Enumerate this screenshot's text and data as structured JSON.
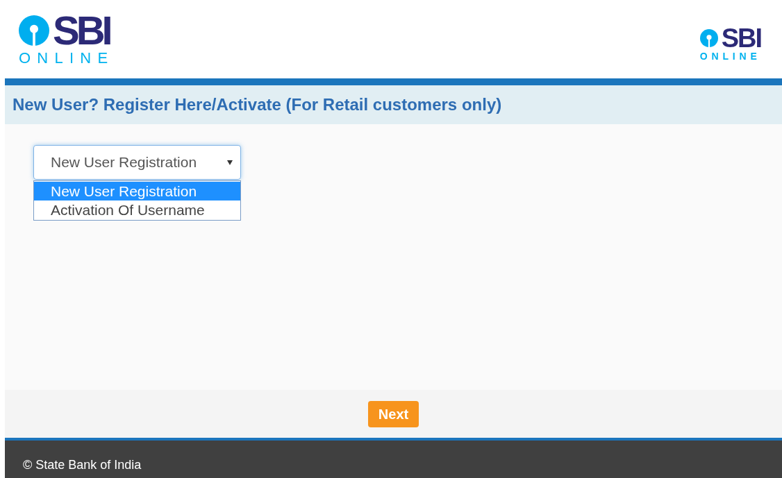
{
  "header": {
    "logos": [
      {
        "wordmark": "SBI",
        "tagline": "ONLINE"
      },
      {
        "wordmark": "SBI",
        "tagline": "ONLINE"
      }
    ]
  },
  "title": "New User? Register Here/Activate (For Retail customers only)",
  "select": {
    "value": "New User Registration",
    "expanded": true,
    "options": [
      {
        "label": "New User Registration",
        "selected": true
      },
      {
        "label": "Activation Of Username",
        "selected": false
      }
    ]
  },
  "buttons": [
    {
      "label": "Next"
    }
  ],
  "footer": {
    "text": "© State Bank of India"
  }
}
